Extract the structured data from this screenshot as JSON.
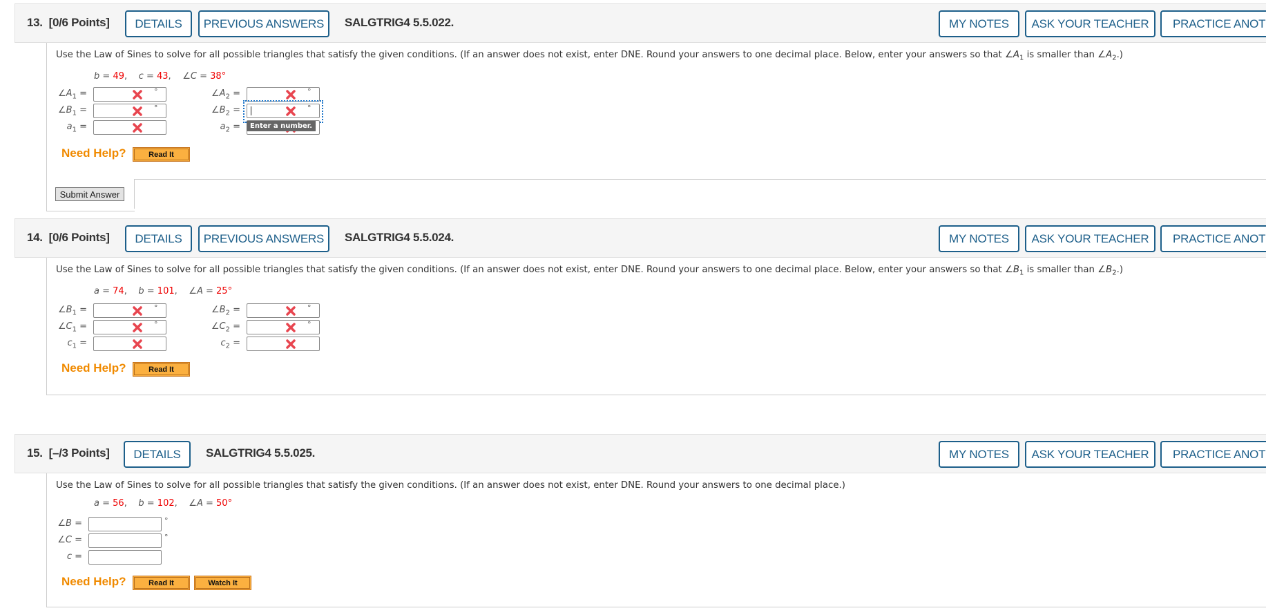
{
  "questions": [
    {
      "number": "13.",
      "points": "[0/6 Points]",
      "details_label": "DETAILS",
      "previous_answers_label": "PREVIOUS ANSWERS",
      "code": "SALGTRIG4 5.5.022.",
      "my_notes_label": "MY NOTES",
      "ask_teacher_label": "ASK YOUR TEACHER",
      "practice_label": "PRACTICE ANOTHER",
      "prompt": "Use the Law of Sines to solve for all possible triangles that satisfy the given conditions. (If an answer does not exist, enter DNE. Round your answers to one decimal place. Below, enter your answers so that ",
      "prompt_cmp_a": "∠A",
      "prompt_cmp_a_sub": "1",
      "prompt_mid": " is smaller than ",
      "prompt_cmp_b": "∠A",
      "prompt_cmp_b_sub": "2",
      "prompt_end": ".)",
      "given": [
        {
          "name": "b",
          "value": "49"
        },
        {
          "name": "c",
          "value": "43"
        },
        {
          "name": "∠C",
          "value": "38°"
        }
      ],
      "left_fields": [
        {
          "label": "∠A",
          "sub": "1",
          "value": "",
          "status": "incorrect",
          "unit": "°"
        },
        {
          "label": "∠B",
          "sub": "1",
          "value": "",
          "status": "incorrect",
          "unit": "°"
        },
        {
          "label": "a",
          "sub": "1",
          "value": "",
          "status": "incorrect",
          "unit": ""
        }
      ],
      "right_fields": [
        {
          "label": "∠A",
          "sub": "2",
          "value": "",
          "status": "incorrect",
          "unit": "°"
        },
        {
          "label": "∠B",
          "sub": "2",
          "value": "",
          "status": "incorrect",
          "unit": "°",
          "focused": true
        },
        {
          "label": "a",
          "sub": "2",
          "value": "",
          "status": "incorrect",
          "unit": ""
        }
      ],
      "tooltip": "Enter a number.",
      "need_help": "Need Help?",
      "help_buttons": [
        "Read It"
      ],
      "submit_label": "Submit Answer"
    },
    {
      "number": "14.",
      "points": "[0/6 Points]",
      "details_label": "DETAILS",
      "previous_answers_label": "PREVIOUS ANSWERS",
      "code": "SALGTRIG4 5.5.024.",
      "my_notes_label": "MY NOTES",
      "ask_teacher_label": "ASK YOUR TEACHER",
      "practice_label": "PRACTICE ANOTHER",
      "prompt": "Use the Law of Sines to solve for all possible triangles that satisfy the given conditions. (If an answer does not exist, enter DNE. Round your answers to one decimal place. Below, enter your answers so that ",
      "prompt_cmp_a": "∠B",
      "prompt_cmp_a_sub": "1",
      "prompt_mid": " is smaller than ",
      "prompt_cmp_b": "∠B",
      "prompt_cmp_b_sub": "2",
      "prompt_end": ".)",
      "given": [
        {
          "name": "a",
          "value": "74"
        },
        {
          "name": "b",
          "value": "101"
        },
        {
          "name": "∠A",
          "value": "25°"
        }
      ],
      "left_fields": [
        {
          "label": "∠B",
          "sub": "1",
          "value": "",
          "status": "incorrect",
          "unit": "°"
        },
        {
          "label": "∠C",
          "sub": "1",
          "value": "",
          "status": "incorrect",
          "unit": "°"
        },
        {
          "label": "c",
          "sub": "1",
          "value": "",
          "status": "incorrect",
          "unit": ""
        }
      ],
      "right_fields": [
        {
          "label": "∠B",
          "sub": "2",
          "value": "",
          "status": "incorrect",
          "unit": "°"
        },
        {
          "label": "∠C",
          "sub": "2",
          "value": "",
          "status": "incorrect",
          "unit": "°"
        },
        {
          "label": "c",
          "sub": "2",
          "value": "",
          "status": "incorrect",
          "unit": ""
        }
      ],
      "need_help": "Need Help?",
      "help_buttons": [
        "Read It"
      ]
    },
    {
      "number": "15.",
      "points": "[–/3 Points]",
      "details_label": "DETAILS",
      "code": "SALGTRIG4 5.5.025.",
      "my_notes_label": "MY NOTES",
      "ask_teacher_label": "ASK YOUR TEACHER",
      "practice_label": "PRACTICE ANOTHER",
      "prompt": "Use the Law of Sines to solve for all possible triangles that satisfy the given conditions. (If an answer does not exist, enter DNE. Round your answers to one decimal place.)",
      "given": [
        {
          "name": "a",
          "value": "56"
        },
        {
          "name": "b",
          "value": "102"
        },
        {
          "name": "∠A",
          "value": "50°"
        }
      ],
      "fields": [
        {
          "label": "∠B",
          "value": "",
          "unit": "°"
        },
        {
          "label": "∠C",
          "value": "",
          "unit": "°"
        },
        {
          "label": "c",
          "value": "",
          "unit": ""
        }
      ],
      "need_help": "Need Help?",
      "help_buttons": [
        "Read It",
        "Watch It"
      ]
    }
  ],
  "colors": {
    "accent": "#1d5f8a",
    "given_value": "#ee0000",
    "need_help": "#f08a00",
    "help_button": "#fbb040",
    "incorrect_icon": "#e8454f"
  },
  "icons": {
    "incorrect": "x-mark-icon"
  }
}
